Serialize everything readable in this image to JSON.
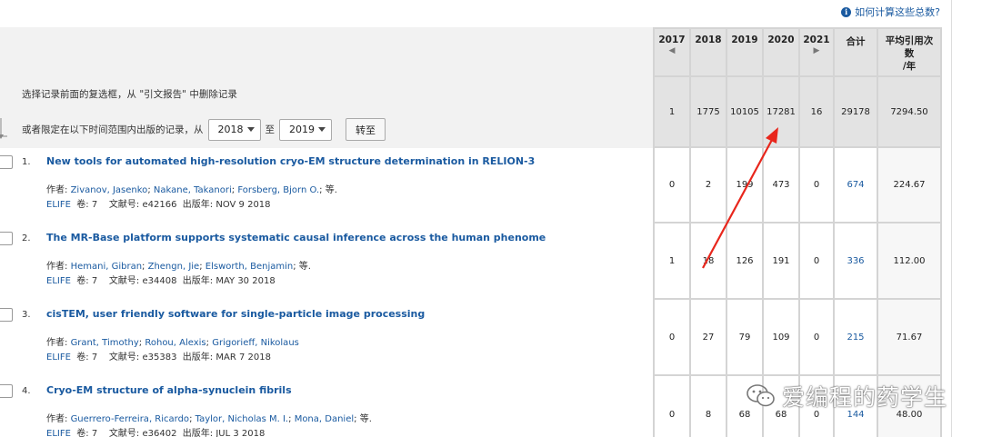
{
  "help_link": "如何计算这些总数?",
  "hint_text": "选择记录前面的复选框，从 \"引文报告\" 中删除记录",
  "limit": {
    "prefix": "或者限定在以下时间范围内出版的记录，从",
    "from_value": "2018",
    "to_label": "至",
    "to_value": "2019",
    "go_button": "转至"
  },
  "table": {
    "headers": [
      "2017",
      "2018",
      "2019",
      "2020",
      "2021",
      "合计",
      "平均引用次\n数\n/年"
    ],
    "header_lines": [
      "平均引用次",
      "数",
      "/年"
    ],
    "totals": [
      "1",
      "1775",
      "10105",
      "17281",
      "16",
      "29178",
      "7294.50"
    ],
    "rows": [
      [
        "0",
        "2",
        "199",
        "473",
        "0",
        "674",
        "224.67"
      ],
      [
        "1",
        "18",
        "126",
        "191",
        "0",
        "336",
        "112.00"
      ],
      [
        "0",
        "27",
        "79",
        "109",
        "0",
        "215",
        "71.67"
      ],
      [
        "0",
        "8",
        "68",
        "68",
        "0",
        "144",
        "48.00"
      ]
    ]
  },
  "records": [
    {
      "num": "1.",
      "title": "New tools for automated high-resolution cryo-EM structure determination in RELION-3",
      "authors_label": "作者:",
      "authors": [
        "Zivanov, Jasenko",
        "Nakane, Takanori",
        "Forsberg, Bjorn O."
      ],
      "authors_suffix": "等.",
      "journal": "ELIFE",
      "volume": "卷: 7",
      "article": "文献号: e42166",
      "pubdate": "出版年:  NOV 9 2018"
    },
    {
      "num": "2.",
      "title": "The MR-Base platform supports systematic causal inference across the human phenome",
      "authors_label": "作者:",
      "authors": [
        "Hemani, Gibran",
        "Zhengn, Jie",
        "Elsworth, Benjamin"
      ],
      "authors_suffix": "等.",
      "journal": "ELIFE",
      "volume": "卷: 7",
      "article": "文献号: e34408",
      "pubdate": "出版年:  MAY 30 2018"
    },
    {
      "num": "3.",
      "title": "cisTEM, user friendly software for single-particle image processing",
      "authors_label": "作者:",
      "authors": [
        "Grant, Timothy",
        "Rohou, Alexis",
        "Grigorieff, Nikolaus"
      ],
      "authors_suffix": "",
      "journal": "ELIFE",
      "volume": "卷: 7",
      "article": "文献号: e35383",
      "pubdate": "出版年:  MAR 7 2018"
    },
    {
      "num": "4.",
      "title": "Cryo-EM structure of alpha-synuclein fibrils",
      "authors_label": "作者:",
      "authors": [
        "Guerrero-Ferreira, Ricardo",
        "Taylor, Nicholas M. I.",
        "Mona, Daniel"
      ],
      "authors_suffix": "等.",
      "journal": "ELIFE",
      "volume": "卷: 7",
      "article": "文献号: e36402",
      "pubdate": "出版年:  JUL 3 2018"
    }
  ],
  "watermark": "爱编程的药学生",
  "colors": {
    "link": "#1a5aa0",
    "annotation": "#e8261c"
  }
}
